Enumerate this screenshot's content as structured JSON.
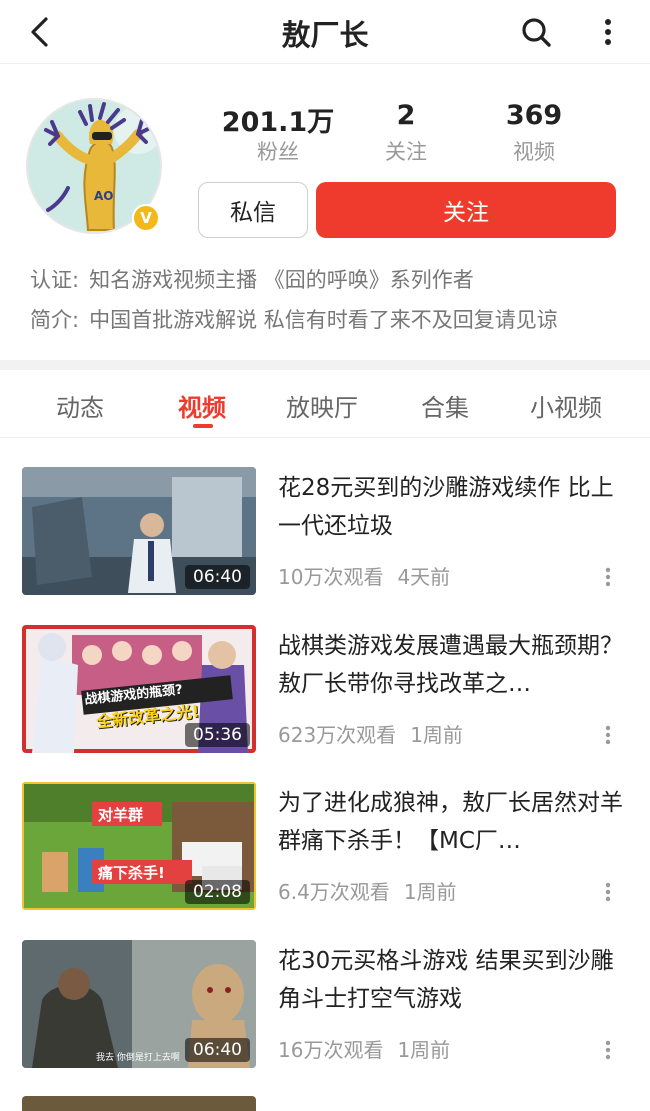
{
  "header": {
    "title": "敖厂长"
  },
  "profile": {
    "stats": [
      {
        "value": "201.1万",
        "label": "粉丝"
      },
      {
        "value": "2",
        "label": "关注"
      },
      {
        "value": "369",
        "label": "视频"
      }
    ],
    "message_button": "私信",
    "follow_button": "关注",
    "badge": "V",
    "certification_label": "认证:",
    "certification": "知名游戏视频主播 《囧的呼唤》系列作者",
    "intro_label": "简介:",
    "intro": "中国首批游戏解说 私信有时看了来不及回复请见谅"
  },
  "tabs": [
    {
      "label": "动态"
    },
    {
      "label": "视频"
    },
    {
      "label": "放映厅"
    },
    {
      "label": "合集"
    },
    {
      "label": "小视频"
    }
  ],
  "active_tab": "视频",
  "videos": [
    {
      "title": "花28元买到的沙雕游戏续作 比上一代还垃圾",
      "duration": "06:40",
      "views": "10万次观看",
      "time": "4天前"
    },
    {
      "title": "战棋类游戏发展遭遇最大瓶颈期？敖厂长带你寻找改革之…",
      "duration": "05:36",
      "views": "623万次观看",
      "time": "1周前",
      "thumb_text_1": "战棋游戏的瓶颈?",
      "thumb_text_2": "全新改革之光!"
    },
    {
      "title": "为了进化成狼神，敖厂长居然对羊群痛下杀手！【MC厂…",
      "duration": "02:08",
      "views": "6.4万次观看",
      "time": "1周前",
      "thumb_text_1": "对羊群",
      "thumb_text_2": "痛下杀手!"
    },
    {
      "title": "花30元买格斗游戏 结果买到沙雕角斗士打空气游戏",
      "duration": "06:40",
      "views": "16万次观看",
      "time": "1周前",
      "thumb_text_1": "我去 你倒是打上去啊"
    }
  ],
  "colors": {
    "accent": "#ee3b2e",
    "muted_text": "#999999",
    "badge": "#f3b81a"
  }
}
